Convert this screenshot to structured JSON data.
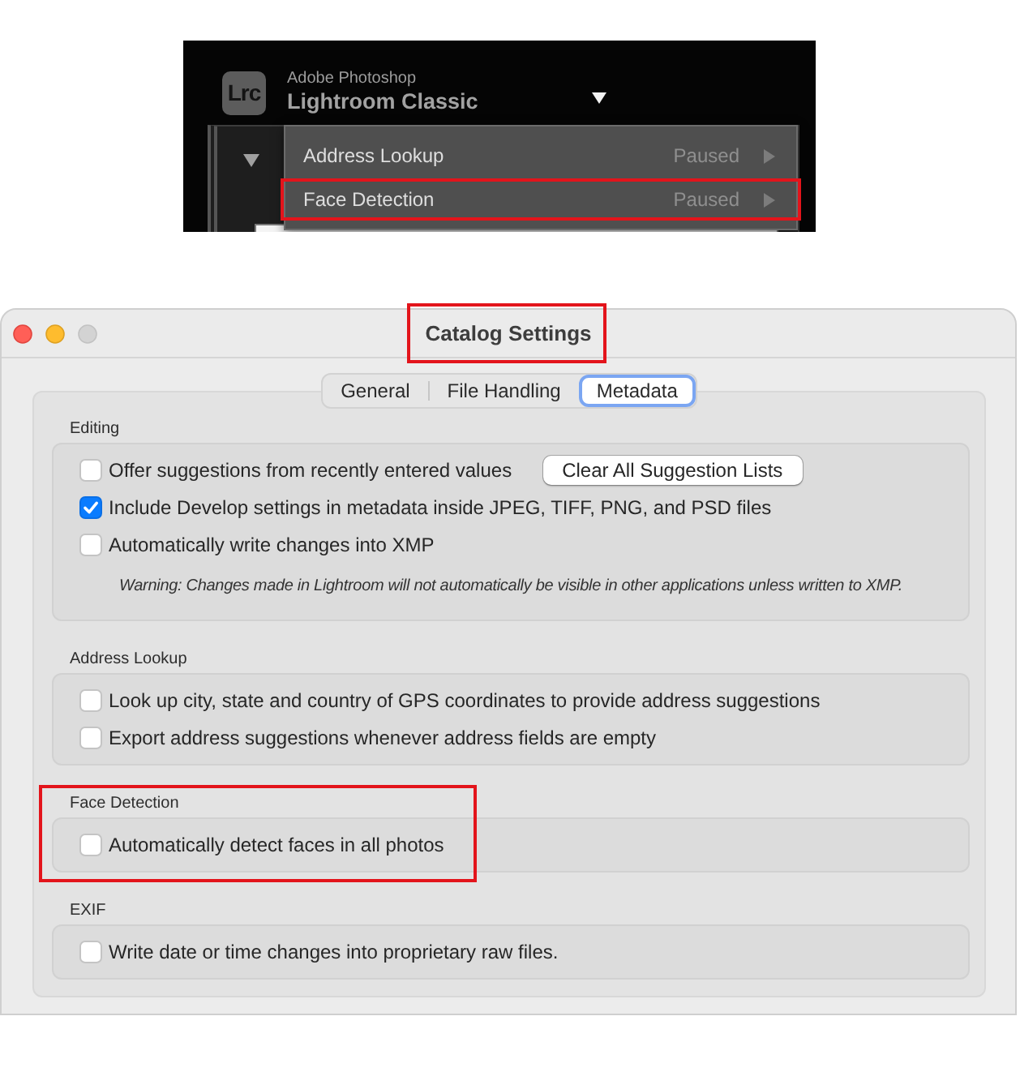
{
  "app_header": {
    "logo_text": "Lrc",
    "brand": "Adobe Photoshop",
    "product": "Lightroom Classic",
    "menu": [
      {
        "label": "Address Lookup",
        "status": "Paused",
        "annotated": false
      },
      {
        "label": "Face Detection",
        "status": "Paused",
        "annotated": true
      }
    ]
  },
  "window": {
    "title": "Catalog Settings",
    "annotated": true,
    "buttons": [
      {
        "kind": "close",
        "disabled": false
      },
      {
        "kind": "minimize",
        "disabled": false
      },
      {
        "kind": "zoom",
        "disabled": true
      }
    ]
  },
  "tabs": [
    {
      "label": "General",
      "selected": false
    },
    {
      "label": "File Handling",
      "selected": false
    },
    {
      "label": "Metadata",
      "selected": true
    }
  ],
  "sections": [
    {
      "title": "Editing",
      "annotated": false,
      "options": [
        {
          "kind": "checkbox",
          "label": "Offer suggestions from recently entered values",
          "checked": false,
          "button": "Clear All Suggestion Lists"
        },
        {
          "kind": "checkbox",
          "label": "Include Develop settings in metadata inside JPEG, TIFF, PNG, and PSD files",
          "checked": true
        },
        {
          "kind": "checkbox",
          "label": "Automatically write changes into XMP",
          "checked": false
        },
        {
          "kind": "note",
          "text": "Warning: Changes made in Lightroom will not automatically be visible in other applications unless written to XMP."
        }
      ]
    },
    {
      "title": "Address Lookup",
      "annotated": false,
      "options": [
        {
          "kind": "checkbox",
          "label": "Look up city, state and country of GPS coordinates to provide address suggestions",
          "checked": false
        },
        {
          "kind": "checkbox",
          "label": "Export address suggestions whenever address fields are empty",
          "checked": false
        }
      ]
    },
    {
      "title": "Face Detection",
      "annotated": true,
      "options": [
        {
          "kind": "checkbox",
          "label": "Automatically detect faces in all photos",
          "checked": false
        }
      ]
    },
    {
      "title": "EXIF",
      "annotated": false,
      "options": [
        {
          "kind": "checkbox",
          "label": "Write date or time changes into proprietary raw files.",
          "checked": false
        }
      ]
    }
  ]
}
